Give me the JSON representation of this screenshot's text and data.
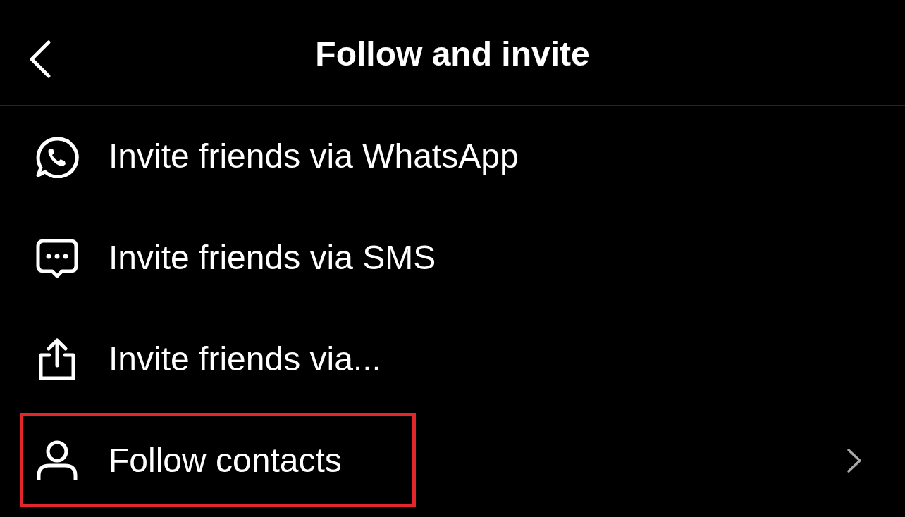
{
  "header": {
    "title": "Follow and invite"
  },
  "items": [
    {
      "kind": "whatsapp",
      "label": "Invite friends via WhatsApp",
      "has_chevron": false,
      "highlighted": false
    },
    {
      "kind": "sms",
      "label": "Invite friends via SMS",
      "has_chevron": false,
      "highlighted": false
    },
    {
      "kind": "share",
      "label": "Invite friends via...",
      "has_chevron": false,
      "highlighted": false
    },
    {
      "kind": "person",
      "label": "Follow contacts",
      "has_chevron": true,
      "highlighted": true
    }
  ]
}
